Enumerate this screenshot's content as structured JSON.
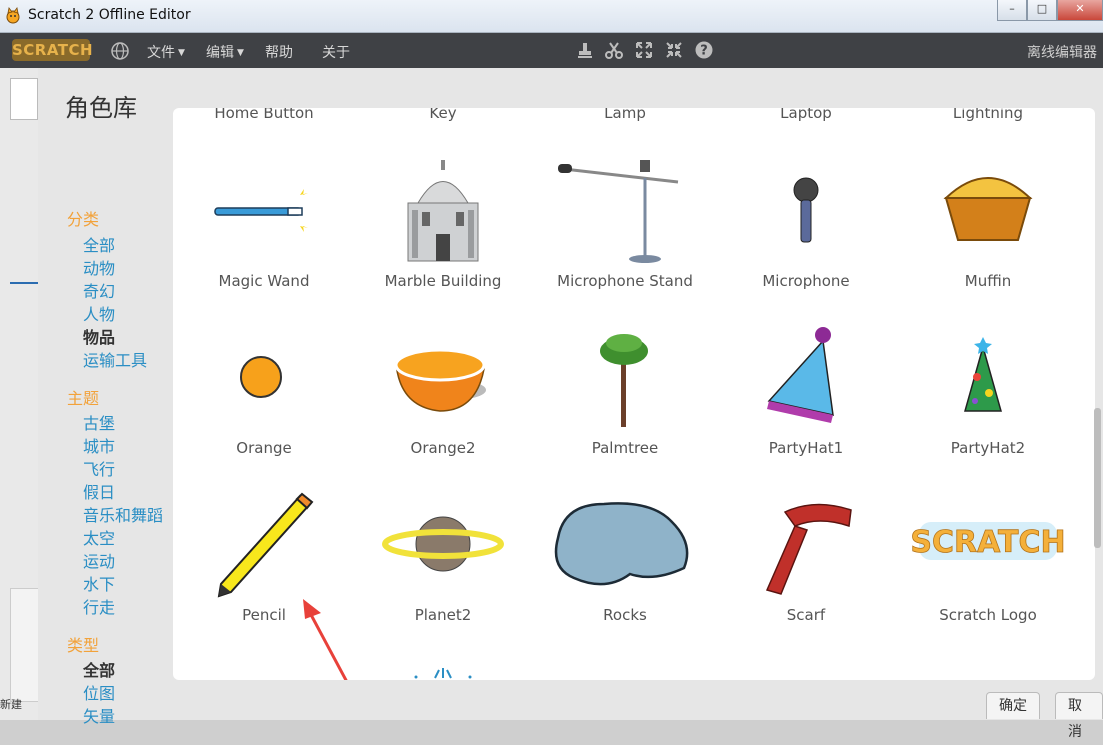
{
  "window": {
    "title": "Scratch 2 Offline Editor",
    "minimize": "–",
    "maximize": "□",
    "close": "✕"
  },
  "menubar": {
    "brand": "SCRATCH",
    "items": [
      {
        "label": "文件",
        "dropdown": true
      },
      {
        "label": "编辑",
        "dropdown": true
      },
      {
        "label": "帮助",
        "dropdown": false
      },
      {
        "label": "关于",
        "dropdown": false
      }
    ],
    "tools": [
      "stamp-icon",
      "scissors-icon",
      "grow-icon",
      "shrink-icon",
      "help-icon"
    ],
    "mode": "离线编辑器"
  },
  "background": {
    "new_label": "新建"
  },
  "dialog": {
    "title": "角色库",
    "sidebar": {
      "sections": [
        {
          "heading": "分类",
          "items": [
            "全部",
            "动物",
            "奇幻",
            "人物",
            "物品",
            "运输工具"
          ],
          "selected": "物品"
        },
        {
          "heading": "主题",
          "items": [
            "古堡",
            "城市",
            "飞行",
            "假日",
            "音乐和舞蹈",
            "太空",
            "运动",
            "水下",
            "行走"
          ],
          "selected": null
        },
        {
          "heading": "类型",
          "items": [
            "全部",
            "位图",
            "矢量"
          ],
          "selected": "全部"
        }
      ]
    },
    "partial_row": [
      "Home Button",
      "Key",
      "Lamp",
      "Laptop",
      "Lightning"
    ],
    "sprites": [
      {
        "name": "Magic Wand",
        "icon": "magic-wand-icon"
      },
      {
        "name": "Marble Building",
        "icon": "marble-building-icon"
      },
      {
        "name": "Microphone Stand",
        "icon": "microphone-stand-icon"
      },
      {
        "name": "Microphone",
        "icon": "microphone-icon"
      },
      {
        "name": "Muffin",
        "icon": "muffin-icon"
      },
      {
        "name": "Orange",
        "icon": "orange-icon"
      },
      {
        "name": "Orange2",
        "icon": "orange-half-icon"
      },
      {
        "name": "Palmtree",
        "icon": "palmtree-icon"
      },
      {
        "name": "PartyHat1",
        "icon": "party-hat-1-icon"
      },
      {
        "name": "PartyHat2",
        "icon": "party-hat-2-icon"
      },
      {
        "name": "Pencil",
        "icon": "pencil-icon"
      },
      {
        "name": "Planet2",
        "icon": "planet-icon"
      },
      {
        "name": "Rocks",
        "icon": "rocks-icon"
      },
      {
        "name": "Scarf",
        "icon": "scarf-icon"
      },
      {
        "name": "Scratch Logo",
        "icon": "scratch-logo-icon"
      }
    ],
    "logo_text": "SCRATCH",
    "ok_label": "确定",
    "cancel_label": "取消"
  },
  "colors": {
    "accent_orange": "#f2a23a",
    "link_blue": "#2a8ec4",
    "menubar": "#3f4145",
    "annotation_arrow": "#e8413a"
  }
}
